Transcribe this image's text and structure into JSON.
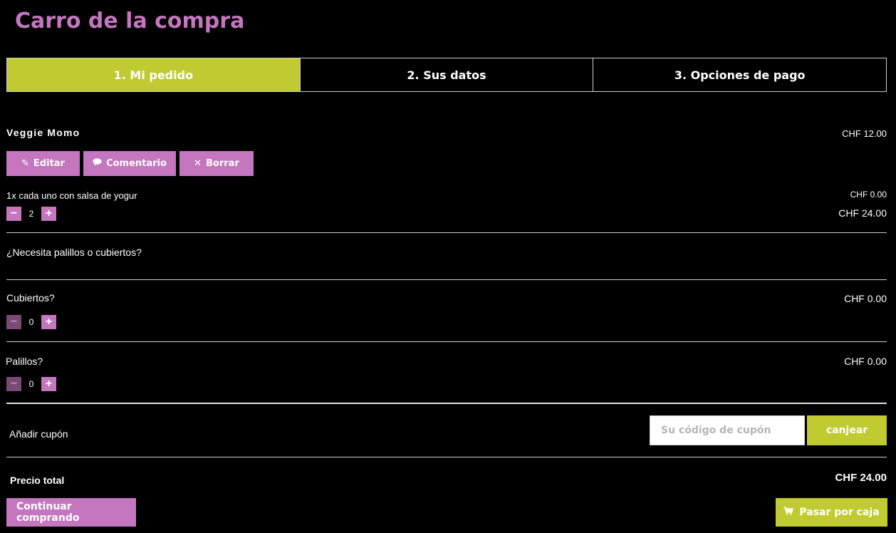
{
  "page": {
    "title": "Carro de la compra"
  },
  "steps": [
    {
      "label": "1. Mi pedido"
    },
    {
      "label": "2. Sus datos"
    },
    {
      "label": "3. Opciones de pago"
    }
  ],
  "item": {
    "name": "Veggie Momo",
    "unit_price": "CHF 12.00",
    "actions": {
      "edit": "Editar",
      "comment": "Comentario",
      "delete": "Borrar"
    },
    "option_text": "1x cada uno con salsa de yogur",
    "option_price": "CHF 0.00",
    "quantity": "2",
    "total": "CHF 24.00"
  },
  "extras": {
    "question": "¿Necesita palillos o cubiertos?",
    "cutlery": {
      "label": "Cubiertos?",
      "price": "CHF 0.00",
      "quantity": "0"
    },
    "chopsticks": {
      "label": "Palillos?",
      "price": "CHF 0.00",
      "quantity": "0"
    }
  },
  "coupon": {
    "label": "Añadir cupón",
    "placeholder": "Su código de cupón",
    "redeem": "canjear"
  },
  "totals": {
    "label": "Precio total",
    "value": "CHF 24.00"
  },
  "footer": {
    "continue": "Continuar comprando",
    "checkout": "Pasar por caja"
  },
  "colors": {
    "accent_pink": "#c476be",
    "accent_green": "#bfcb31",
    "background": "#000000"
  }
}
